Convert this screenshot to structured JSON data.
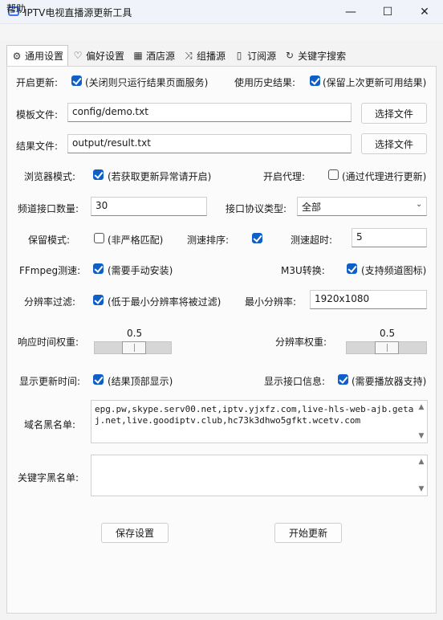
{
  "window": {
    "title": "IPTV电视直播源更新工具",
    "minimize": "—",
    "maximize": "☐",
    "close": "✕"
  },
  "menu": {
    "help": "帮助"
  },
  "tabs": [
    {
      "label": "通用设置",
      "icon": "⚙"
    },
    {
      "label": "偏好设置",
      "icon": "♡"
    },
    {
      "label": "酒店源",
      "icon": "▦"
    },
    {
      "label": "组播源",
      "icon": "⤨"
    },
    {
      "label": "订阅源",
      "icon": "▯"
    },
    {
      "label": "关键字搜索",
      "icon": "↻"
    }
  ],
  "settings": {
    "open_update": {
      "label": "开启更新:",
      "text": "(关闭则只运行结果页面服务)"
    },
    "use_history": {
      "label": "使用历史结果:",
      "text": "(保留上次更新可用结果)"
    },
    "template_file": {
      "label": "模板文件:",
      "value": "config/demo.txt",
      "button": "选择文件"
    },
    "result_file": {
      "label": "结果文件:",
      "value": "output/result.txt",
      "button": "选择文件"
    },
    "browser_mode": {
      "label": "浏览器模式:",
      "text": "(若获取更新异常请开启)"
    },
    "proxy": {
      "label": "开启代理:",
      "text": "(通过代理进行更新)"
    },
    "channel_count": {
      "label": "频道接口数量:",
      "value": "30"
    },
    "protocol_type": {
      "label": "接口协议类型:",
      "value": "全部"
    },
    "keep_mode": {
      "label": "保留模式:",
      "text": "(非严格匹配)"
    },
    "speed_sort": {
      "label": "测速排序:"
    },
    "speed_timeout": {
      "label": "测速超时:",
      "value": "5"
    },
    "ffmpeg": {
      "label": "FFmpeg测速:",
      "text": "(需要手动安装)"
    },
    "m3u": {
      "label": "M3U转换:",
      "text": "(支持频道图标)"
    },
    "resolution_filter": {
      "label": "分辨率过滤:",
      "text": "(低于最小分辨率将被过滤)"
    },
    "min_resolution": {
      "label": "最小分辨率:",
      "value": "1920x1080"
    },
    "response_weight": {
      "label": "响应时间权重:",
      "value": "0.5"
    },
    "resolution_weight": {
      "label": "分辨率权重:",
      "value": "0.5"
    },
    "show_update_time": {
      "label": "显示更新时间:",
      "text": "(结果顶部显示)"
    },
    "show_interface_info": {
      "label": "显示接口信息:",
      "text": "(需要播放器支持)"
    },
    "domain_blacklist": {
      "label": "域名黑名单:",
      "value": "epg.pw,skype.serv00.net,iptv.yjxfz.com,live-hls-web-ajb.getaj.net,live.goodiptv.club,hc73k3dhwo5gfkt.wcetv.com"
    },
    "keyword_blacklist": {
      "label": "关键字黑名单:",
      "value": ""
    }
  },
  "actions": {
    "save": "保存设置",
    "start": "开始更新"
  },
  "colors": {
    "accent": "#0f5fc7"
  }
}
